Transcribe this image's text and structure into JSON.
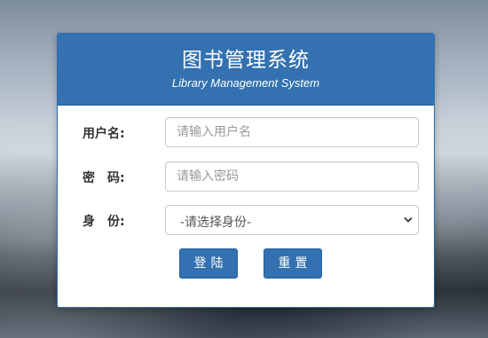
{
  "header": {
    "title": "图书管理系统",
    "subtitle": "Library Management System"
  },
  "form": {
    "username": {
      "label": "用户名:",
      "placeholder": "请输入用户名",
      "value": ""
    },
    "password": {
      "label": "密　码:",
      "placeholder": "请输入密码",
      "value": ""
    },
    "role": {
      "label": "身　份:",
      "selected": "-请选择身份-"
    }
  },
  "buttons": {
    "login": "登陆",
    "reset": "重置"
  },
  "colors": {
    "primary": "#3371b0",
    "label_text": "#333333",
    "border": "#cccccc"
  }
}
